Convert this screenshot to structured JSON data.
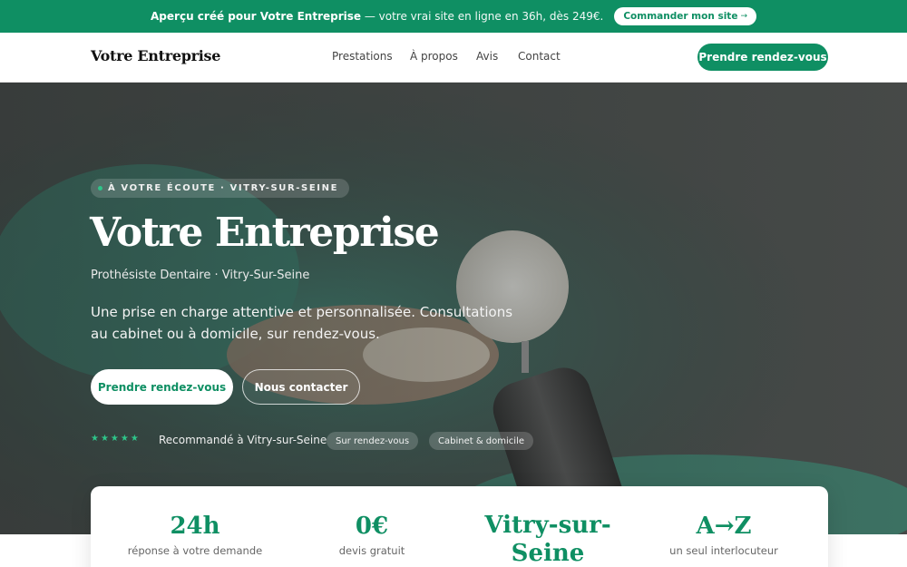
{
  "promo": {
    "bold": "Aperçu créé pour Votre Entreprise",
    "rest": " — votre vrai site en ligne en 36h, dès 249€.",
    "button": "Commander mon site",
    "button_arrow": "→"
  },
  "header": {
    "brand": "Votre Entreprise",
    "nav": [
      "Prestations",
      "À propos",
      "Avis",
      "Contact"
    ],
    "cta": "Prendre rendez-vous"
  },
  "hero": {
    "eyebrow": "À VOTRE ÉCOUTE · VITRY-SUR-SEINE",
    "title": "Votre Entreprise",
    "subtitle": "Prothésiste Dentaire · Vitry-Sur-Seine",
    "description": "Une prise en charge attentive et personnalisée. Consultations au cabinet ou à domicile, sur rendez-vous.",
    "primary_button": "Prendre rendez-vous",
    "secondary_button": "Nous contacter",
    "stars": "★★★★★",
    "recommend": "Recommandé à Vitry-sur-Seine",
    "chips": [
      "Sur rendez-vous",
      "Cabinet & domicile"
    ]
  },
  "stats": [
    {
      "value": "24h",
      "label": "réponse à votre demande"
    },
    {
      "value": "0€",
      "label": "devis gratuit"
    },
    {
      "value": "Vitry-sur-Seine",
      "label": ""
    },
    {
      "value": "A→Z",
      "label": "un seul interlocuteur"
    }
  ],
  "colors": {
    "accent": "#0f8f63",
    "accent_light": "#2ec489"
  }
}
